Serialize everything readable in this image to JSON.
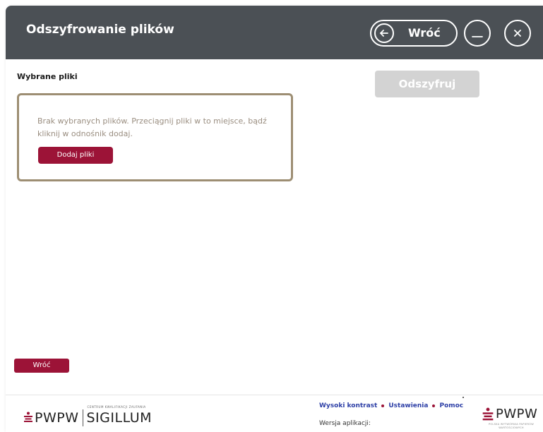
{
  "window": {
    "title": "Odszyfrowanie plików"
  },
  "header": {
    "back_label": "Wróć",
    "icons": {
      "back": "arrow-left-icon",
      "minimize": "minimize-icon",
      "close": "close-icon"
    }
  },
  "main": {
    "files_label": "Wybrane pliki",
    "decrypt_label": "Odszyfruj",
    "drop_zone": {
      "message": "Brak wybranych plików. Przeciągnij pliki w to miejsce, bądź kliknij w odnośnik dodaj.",
      "add_button": "Dodaj pliki"
    },
    "back_button": "Wróć"
  },
  "footer": {
    "logo_left": {
      "pwpw": "PWPW",
      "sigillum": "SIGILLUM",
      "sigillum_caption": "CENTRUM KWALIFIKACJI ZAUFANIA"
    },
    "links": [
      "Wysoki kontrast",
      "Ustawienia",
      "Pomoc"
    ],
    "version_label": "Wersja aplikacji:",
    "logo_right": {
      "pwpw": "PWPW",
      "caption": "POLSKA WYTWÓRNIA PAPIERÓW WARTOŚCIOWYCH"
    }
  },
  "colors": {
    "header_bg": "#4b5055",
    "accent": "#9c1337",
    "disabled": "#d3d3d3",
    "drop_border": "#9d8e73",
    "link": "#2d3fa6"
  }
}
